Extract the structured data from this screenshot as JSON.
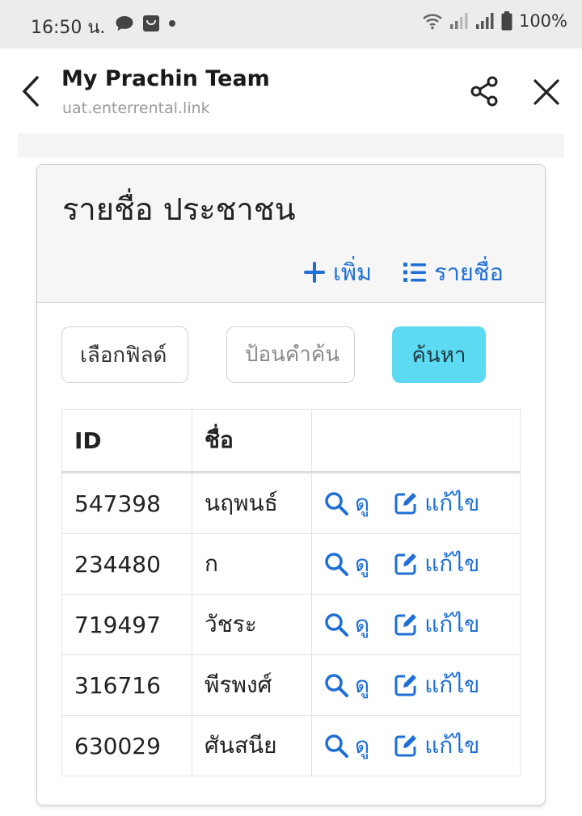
{
  "status_bar": {
    "time": "16:50 น.",
    "battery": "100%"
  },
  "app_bar": {
    "title": "My Prachin Team",
    "url": "uat.enterrental.link"
  },
  "card": {
    "title": "รายชื่อ ประชาชน",
    "add_label": "เพิ่ม",
    "list_label": "รายชื่อ"
  },
  "search": {
    "field_select": "เลือกฟิลด์",
    "keyword_placeholder": "ป้อนคำค้น",
    "button_label": "ค้นหา"
  },
  "table": {
    "headers": [
      "ID",
      "ชื่อ",
      ""
    ],
    "view_label": "ดู",
    "edit_label": "แก้ไข",
    "rows": [
      {
        "id": "547398",
        "name": "นฤพนธ์"
      },
      {
        "id": "234480",
        "name": "ก"
      },
      {
        "id": "719497",
        "name": "วัชระ"
      },
      {
        "id": "316716",
        "name": "พีรพงศ์"
      },
      {
        "id": "630029",
        "name": "ศันสนีย"
      }
    ]
  },
  "colors": {
    "accent": "#1f6fd6",
    "search_button": "#5cdaf2",
    "status_bar_bg": "#ececec"
  },
  "icons": [
    "chat-icon",
    "bag-icon",
    "wifi-icon",
    "signal-icon",
    "battery-icon",
    "back-icon",
    "share-icon",
    "close-icon",
    "plus-icon",
    "list-icon",
    "search-icon",
    "edit-icon"
  ]
}
